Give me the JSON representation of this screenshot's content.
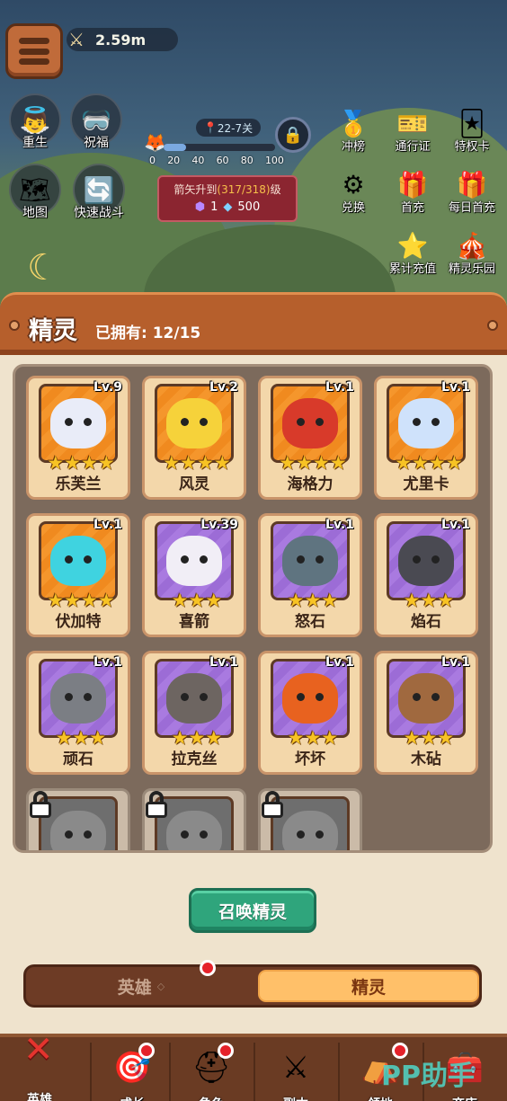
{
  "top": {
    "power_value": "2.59m",
    "left_buttons": [
      {
        "label": "重生",
        "icon": "angel-icon"
      },
      {
        "label": "祝福",
        "icon": "goggles-icon"
      },
      {
        "label": "地图",
        "icon": "map-icon"
      },
      {
        "label": "快速战斗",
        "icon": "fast-battle-icon"
      }
    ],
    "stage": {
      "label": "22-7关",
      "progress_percent": 20,
      "ticks": [
        "0",
        "20",
        "40",
        "60",
        "80",
        "100"
      ]
    },
    "quest": {
      "prefix": "箭矢升到",
      "progress": "(317/318)",
      "suffix": "级",
      "reward_purple": "1",
      "reward_blue": "500"
    },
    "features": [
      {
        "label": "冲榜",
        "icon": "rank-badge-icon"
      },
      {
        "label": "通行证",
        "icon": "pass-icon"
      },
      {
        "label": "特权卡",
        "icon": "privilege-card-icon"
      },
      {
        "label": "兑换",
        "icon": "exchange-icon"
      },
      {
        "label": "首充",
        "icon": "first-charge-gift-icon"
      },
      {
        "label": "每日首充",
        "icon": "daily-gift-icon"
      },
      {
        "label": "累计充值",
        "icon": "cumulative-recharge-icon"
      },
      {
        "label": "精灵乐园",
        "icon": "spirit-park-icon"
      }
    ]
  },
  "panel": {
    "title": "精灵",
    "owned": "已拥有: 12/15"
  },
  "spirits": [
    {
      "name": "乐芙兰",
      "level": "Lv.9",
      "stars": "★★★★",
      "tier": "orange",
      "color": "#e9ecf8"
    },
    {
      "name": "风灵",
      "level": "Lv.2",
      "stars": "★★★★",
      "tier": "orange",
      "color": "#f6d23a"
    },
    {
      "name": "海格力",
      "level": "Lv.1",
      "stars": "★★★★",
      "tier": "orange",
      "color": "#d83a2a"
    },
    {
      "name": "尤里卡",
      "level": "Lv.1",
      "stars": "★★★★",
      "tier": "orange",
      "color": "#cfe2fb"
    },
    {
      "name": "伏加特",
      "level": "Lv.1",
      "stars": "★★★★",
      "tier": "orange",
      "color": "#3fd3e0"
    },
    {
      "name": "喜箭",
      "level": "Lv.39",
      "stars": "★★★",
      "tier": "purple",
      "color": "#f1eef6"
    },
    {
      "name": "怒石",
      "level": "Lv.1",
      "stars": "★★★",
      "tier": "purple",
      "color": "#5f7480"
    },
    {
      "name": "焰石",
      "level": "Lv.1",
      "stars": "★★★",
      "tier": "purple",
      "color": "#4a4a52"
    },
    {
      "name": "顽石",
      "level": "Lv.1",
      "stars": "★★★",
      "tier": "purple",
      "color": "#7b7e84"
    },
    {
      "name": "拉克丝",
      "level": "Lv.1",
      "stars": "★★★",
      "tier": "purple",
      "color": "#6d6561"
    },
    {
      "name": "坏坏",
      "level": "Lv.1",
      "stars": "★★★",
      "tier": "purple",
      "color": "#e8621f"
    },
    {
      "name": "木砧",
      "level": "Lv.1",
      "stars": "★★★",
      "tier": "purple",
      "color": "#a0693f"
    }
  ],
  "locked_count": 3,
  "summon_button": "召唤精灵",
  "toggle": {
    "left": "英雄",
    "right": "精灵",
    "active": "精灵"
  },
  "bottom_nav": [
    {
      "label": "英雄",
      "icon": "close-icon"
    },
    {
      "label": "成长",
      "icon": "scarecrow-icon"
    },
    {
      "label": "角色",
      "icon": "helmet-icon"
    },
    {
      "label": "副本",
      "icon": "crossed-swords-icon"
    },
    {
      "label": "领地",
      "icon": "tent-icon"
    },
    {
      "label": "商店",
      "icon": "treasure-chest-icon"
    }
  ],
  "watermark": "PP助手",
  "colors": {
    "star": "#f7c324",
    "summon_green": "#2fa57c",
    "wood": "#b65f2c",
    "notification_red": "#e5222a"
  }
}
